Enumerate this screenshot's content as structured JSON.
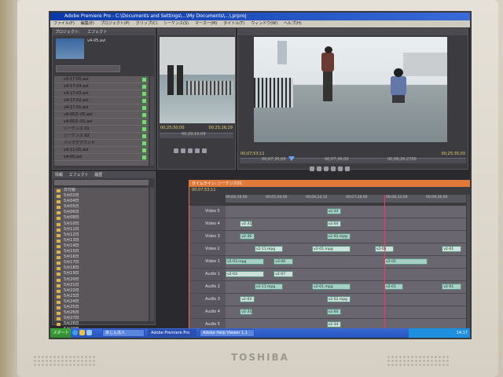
{
  "window": {
    "title": "Adobe Premiere Pro - C:\\Documents and Settings\\...\\My Documents\\...\\.prproj"
  },
  "menu": {
    "items": [
      "ファイル(F)",
      "編集(E)",
      "プロジェクト(P)",
      "クリップ(C)",
      "シーケンス(S)",
      "マーカー(M)",
      "タイトル(T)",
      "ウィンドウ(W)",
      "ヘルプ(H)"
    ]
  },
  "project_panel": {
    "tabs": [
      "プロジェクト:",
      "エフェクト"
    ],
    "clip_name": "v4-05.avi",
    "items": [
      "v4-17-05.avi",
      "v4-17-04.avi",
      "v4-17-03.avi",
      "v4-17-02.avi",
      "v4-17-01.avi",
      "v4-05ホ-05.avi",
      "v4-05ホ-01.avi",
      "シーケンス 01",
      "シーケンス 02",
      "バックグラウンド",
      "v4-11-01.avi",
      "v4-00.avi"
    ]
  },
  "source_monitor": {
    "tc_in": "00;25;50;00",
    "tc_out": "00;25;26;29",
    "tc_mid": "00;20;15;09"
  },
  "program_monitor": {
    "tc_in": "00;07;53;11",
    "tc_out": "00;25;35;03",
    "tc_marks": [
      "00;07;30;00",
      "00;07;36;00",
      "00;08;26;2700"
    ]
  },
  "browser_panel": {
    "tabs": [
      "情報",
      "エフェクト",
      "履歴"
    ],
    "items": [
      "日付順",
      "5月02日",
      "5月04日",
      "5月05日",
      "5月06日",
      "5月08日",
      "5月10日",
      "5月11日",
      "5月12日",
      "5月13日",
      "5月14日",
      "5月15日",
      "5月16日",
      "5月17日",
      "5月18日",
      "5月19日",
      "5月20日",
      "5月21日",
      "5月22日",
      "5月23日",
      "5月24日",
      "5月25日",
      "5月26日",
      "5月27日",
      "5月28日",
      "5月29日",
      "5月30日",
      "5月31日"
    ]
  },
  "timeline": {
    "tab": "タイムライン: シーケンス01",
    "timecode": "00;07;53;11",
    "ruler_marks": [
      "00;04;16;00",
      "00;05;20;00",
      "00;06;24;12",
      "00;07;28;00",
      "00;08;32;00",
      "00;09;36;00"
    ],
    "playhead_fraction": 0.66,
    "tracks": [
      {
        "label": "Video 5",
        "clips": [
          {
            "name": "v2-34",
            "start": 0.42,
            "len": 0.06
          }
        ]
      },
      {
        "label": "Video 4",
        "clips": [
          {
            "name": "v2-31",
            "start": 0.06,
            "len": 0.05
          },
          {
            "name": "v2-04",
            "start": 0.42,
            "len": 0.06
          }
        ]
      },
      {
        "label": "Video 3",
        "clips": [
          {
            "name": "v2-36",
            "start": 0.06,
            "len": 0.06
          },
          {
            "name": "v2-02.mpg",
            "start": 0.42,
            "len": 0.1
          }
        ]
      },
      {
        "label": "Video 2",
        "clips": [
          {
            "name": "v2-11.mpg",
            "start": 0.12,
            "len": 0.12
          },
          {
            "name": "v2-01.mpg",
            "start": 0.36,
            "len": 0.16
          },
          {
            "name": "v2-01",
            "start": 0.62,
            "len": 0.08
          },
          {
            "name": "v2-01",
            "start": 0.9,
            "len": 0.08
          }
        ]
      },
      {
        "label": "Video 1",
        "clips": [
          {
            "name": "v2-03.mpg",
            "start": 0.0,
            "len": 0.16
          },
          {
            "name": "v3-00",
            "start": 0.2,
            "len": 0.08
          },
          {
            "name": "v2-05",
            "start": 0.66,
            "len": 0.18
          }
        ]
      },
      {
        "label": "Audio 1",
        "clips": [
          {
            "name": "v2-03",
            "start": 0.0,
            "len": 0.16
          },
          {
            "name": "v2-07",
            "start": 0.2,
            "len": 0.08
          }
        ]
      },
      {
        "label": "Audio 2",
        "clips": [
          {
            "name": "v2-11.mpg",
            "start": 0.12,
            "len": 0.12
          },
          {
            "name": "v2-01.mpg",
            "start": 0.36,
            "len": 0.16
          },
          {
            "name": "v2-01",
            "start": 0.66,
            "len": 0.08
          },
          {
            "name": "v2-01",
            "start": 0.9,
            "len": 0.08
          }
        ]
      },
      {
        "label": "Audio 3",
        "clips": [
          {
            "name": "v2-04",
            "start": 0.06,
            "len": 0.06
          },
          {
            "name": "v2-02.mpg",
            "start": 0.42,
            "len": 0.1
          }
        ]
      },
      {
        "label": "Audio 4",
        "clips": [
          {
            "name": "v2-31",
            "start": 0.06,
            "len": 0.05
          },
          {
            "name": "v2-04",
            "start": 0.42,
            "len": 0.06
          }
        ]
      },
      {
        "label": "Audio 5",
        "clips": [
          {
            "name": "v2-34",
            "start": 0.42,
            "len": 0.06
          }
        ]
      }
    ]
  },
  "taskbar": {
    "start_label": "スタート",
    "tasks": [
      "あじん法人",
      "Adobe Premiere Pro",
      "Adobe Help Viewer 1.1"
    ],
    "clock": "14:17"
  },
  "bezel": {
    "brand": "TOSHIBA"
  }
}
